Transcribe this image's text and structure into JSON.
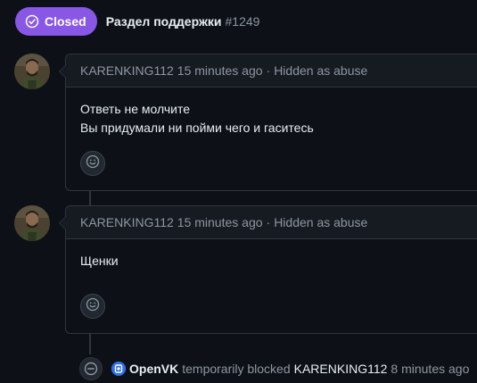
{
  "header": {
    "state_label": "Closed",
    "title": "Раздел поддержки",
    "number": "#1249"
  },
  "comments": [
    {
      "author": "KARENKING112",
      "time": "15 minutes ago",
      "separator": "·",
      "status": "Hidden as abuse",
      "lines": [
        "Ответь не молчите",
        "Вы придумали ни пойми чего и гаситесь"
      ],
      "reaction_icon": "smiley-icon"
    },
    {
      "author": "KARENKING112",
      "time": "15 minutes ago",
      "separator": "·",
      "status": "Hidden as abuse",
      "lines": [
        "Щенки"
      ],
      "reaction_icon": "smiley-icon"
    }
  ],
  "event": {
    "icon": "blocked-icon",
    "actor": "OpenVK",
    "action": "temporarily blocked",
    "subject": "KARENKING112",
    "time": "8 minutes ago"
  },
  "colors": {
    "background": "#0d1117",
    "closed_badge": "#8957e5",
    "border": "#30363d",
    "header_bg": "#161b22",
    "muted_text": "#8d96a0",
    "text": "#e6edf3"
  }
}
